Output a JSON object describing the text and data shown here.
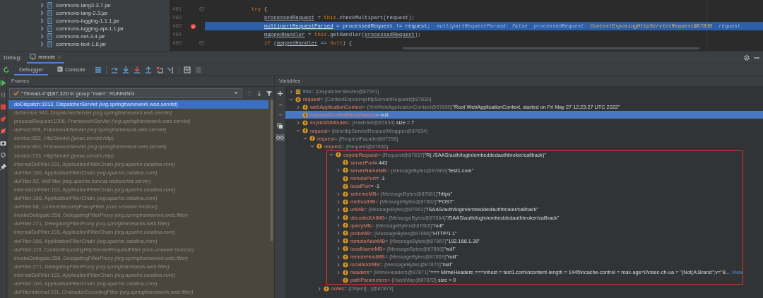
{
  "project_tree": {
    "items": [
      {
        "label": "commons-lang3-3.7.jar",
        "expanded": false
      },
      {
        "label": "commons-lang-2.3.jar",
        "expanded": false
      },
      {
        "label": "commons-logging-1.1.1.jar",
        "expanded": false
      },
      {
        "label": "commons-logging-api-1.1.jar",
        "expanded": false
      },
      {
        "label": "commons-net-3.4.jar",
        "expanded": false
      },
      {
        "label": "commons-text-1.8.jar",
        "expanded": false
      }
    ]
  },
  "editor": {
    "lines": [
      {
        "number": "481",
        "kind": "block",
        "breakpoint": false,
        "selected": false,
        "fold": true,
        "tokens": [
          {
            "t": "try",
            "kind": "keyword"
          },
          {
            "t": " {",
            "kind": "plain"
          }
        ]
      },
      {
        "number": "482",
        "kind": "statement",
        "breakpoint": false,
        "selected": false,
        "fold": false,
        "tokens": [
          {
            "t": "processedRequest",
            "kind": "field"
          },
          {
            "t": " = ",
            "kind": "plain"
          },
          {
            "t": "this",
            "kind": "keyword"
          },
          {
            "t": ".checkMultipart(request);",
            "kind": "plain"
          }
        ]
      },
      {
        "number": "483",
        "kind": "statement",
        "breakpoint": true,
        "selected": true,
        "fold": false,
        "tokens": [
          {
            "t": "multipartRequestParsed",
            "kind": "field"
          },
          {
            "t": " = processedRequest != request;",
            "kind": "plain"
          },
          {
            "t": "  multipartRequestParsed: false  processedRequest: ",
            "kind": "hint"
          },
          {
            "t": "ContextExposingHttpServletRequest@87830",
            "kind": "hintvalue"
          },
          {
            "t": "  request: ",
            "kind": "hint"
          }
        ]
      },
      {
        "number": "484",
        "kind": "statement",
        "breakpoint": false,
        "selected": false,
        "fold": false,
        "tokens": [
          {
            "t": "mappedHandler",
            "kind": "field"
          },
          {
            "t": " = ",
            "kind": "plain"
          },
          {
            "t": "this",
            "kind": "keyword"
          },
          {
            "t": ".getHandler(",
            "kind": "plain"
          },
          {
            "t": "processedRequest",
            "kind": "field"
          },
          {
            "t": ");",
            "kind": "plain"
          }
        ]
      },
      {
        "number": "485",
        "kind": "statement",
        "breakpoint": false,
        "selected": false,
        "fold": true,
        "tokens": [
          {
            "t": "if",
            "kind": "keyword"
          },
          {
            "t": " (",
            "kind": "plain"
          },
          {
            "t": "mappedHandler",
            "kind": "field"
          },
          {
            "t": " == ",
            "kind": "plain"
          },
          {
            "t": "null",
            "kind": "keyword"
          },
          {
            "t": ") {",
            "kind": "plain"
          }
        ]
      }
    ]
  },
  "debug": {
    "label": "Debug:",
    "session_tab": "remote",
    "tabs": [
      {
        "label": "Debugger",
        "selected": true
      },
      {
        "label": "Console",
        "selected": false
      }
    ]
  },
  "frames": {
    "title": "Frames",
    "thread": "\"Thread-4\"@87,320 in group \"main\": RUNNING",
    "items": [
      {
        "text": "doDispatch:1013, DispatcherServlet *(org.springframework.web.servlet)*",
        "selected": true
      },
      {
        "text": "doService:943, DispatcherServlet *(org.springframework.web.servlet)*",
        "selected": false
      },
      {
        "text": "processRequest:1006, FrameworkServlet *(org.springframework.web.servlet)*",
        "selected": false
      },
      {
        "text": "doPost:909, FrameworkServlet *(org.springframework.web.servlet)*",
        "selected": false
      },
      {
        "text": "service:652, HttpServlet *(javax.servlet.http)*",
        "selected": false
      },
      {
        "text": "service:883, FrameworkServlet *(org.springframework.web.servlet)*",
        "selected": false
      },
      {
        "text": "service:733, HttpServlet *(javax.servlet.http)*",
        "selected": false
      },
      {
        "text": "internalDoFilter:231, ApplicationFilterChain *(org.apache.catalina.core)*",
        "selected": false
      },
      {
        "text": "doFilter:166, ApplicationFilterChain *(org.apache.catalina.core)*",
        "selected": false
      },
      {
        "text": "doFilter:52, WsFilter *(org.apache.tomcat.websocket.server)*",
        "selected": false
      },
      {
        "text": "internalDoFilter:193, ApplicationFilterChain *(org.apache.catalina.core)*",
        "selected": false
      },
      {
        "text": "doFilter:166, ApplicationFilterChain *(org.apache.catalina.core)*",
        "selected": false
      },
      {
        "text": "doFilter:68, ContentSecurityPolicyFilter *(com.vmware.horizon)*",
        "selected": false
      },
      {
        "text": "invokeDelegate:358, DelegatingFilterProxy *(org.springframework.web.filter)*",
        "selected": false
      },
      {
        "text": "doFilter:271, DelegatingFilterProxy *(org.springframework.web.filter)*",
        "selected": false
      },
      {
        "text": "internalDoFilter:193, ApplicationFilterChain *(org.apache.catalina.core)*",
        "selected": false
      },
      {
        "text": "doFilter:166, ApplicationFilterChain *(org.apache.catalina.core)*",
        "selected": false
      },
      {
        "text": "doFilter:119, ContextExposingHttpServletRequestFilter *(com.vmware.horizon)*",
        "selected": false
      },
      {
        "text": "invokeDelegate:358, DelegatingFilterProxy *(org.springframework.web.filter)*",
        "selected": false
      },
      {
        "text": "doFilter:271, DelegatingFilterProxy *(org.springframework.web.filter)*",
        "selected": false
      },
      {
        "text": "internalDoFilter:193, ApplicationFilterChain *(org.apache.catalina.core)*",
        "selected": false
      },
      {
        "text": "doFilter:166, ApplicationFilterChain *(org.apache.catalina.core)*",
        "selected": false
      },
      {
        "text": "doFilterInternal:201, CharacterEncodingFilter *(org.springframework.web.filter)*",
        "selected": false
      }
    ]
  },
  "variables": {
    "title": "Variables",
    "items": [
      {
        "name": "this",
        "type": "= {DispatcherServlet@87091}",
        "kind": "object",
        "expanded": false,
        "selected": false
      },
      {
        "name": "request",
        "type": "= {ContextExposingHttpServletRequest@87830}",
        "kind": "parameter",
        "expanded": true,
        "selected": false,
        "children": [
          {
            "name": "webApplicationContext",
            "type": "= {XmlWebApplicationContext@87095}",
            "value": "\"Root WebApplicationContext, started on Fri May 27 12:23:27 UTC 2022\"",
            "kind": "field",
            "expanded": false,
            "selected": false
          },
          {
            "name": "exposedContextBeanNames",
            "value": "= null",
            "kind": "field",
            "selected": true
          },
          {
            "name": "explicitAttributes",
            "type": "= {HashSet@87833}",
            "value": " size = 7",
            "kind": "field",
            "expanded": false,
            "selected": false
          },
          {
            "name": "request",
            "type": "= {IdmHttpServletRequestWrapper@87834}",
            "kind": "field",
            "expanded": true,
            "selected": false,
            "children": [
              {
                "name": "request",
                "type": "= {RequestFacade@87258}",
                "kind": "field",
                "expanded": true,
                "selected": false,
                "children": [
                  {
                    "name": "request",
                    "type": "= {Request@87836}",
                    "kind": "field",
                    "expanded": true,
                    "selected": false,
                    "children": [
                      {
                        "name": "coyoteRequest",
                        "type": "= {Request@87837}",
                        "value": "\"R( /SAAS/auth/login/embeddedauthbroker/callback)\"",
                        "kind": "field",
                        "expanded": true,
                        "selected": false,
                        "boxed": true,
                        "children": [
                          {
                            "name": "serverPort",
                            "value": "= 443",
                            "kind": "field",
                            "selected": false
                          },
                          {
                            "name": "serverNameMB",
                            "type": "= {MessageBytes@87860}",
                            "value": "\"test1.com\"",
                            "kind": "field",
                            "expanded": false,
                            "selected": false
                          },
                          {
                            "name": "remotePort",
                            "value": "= -1",
                            "kind": "field",
                            "selected": false
                          },
                          {
                            "name": "localPort",
                            "value": "= -1",
                            "kind": "field",
                            "selected": false
                          },
                          {
                            "name": "schemeMB",
                            "type": "= {MessageBytes@87861}",
                            "value": "\"https\"",
                            "kind": "field",
                            "expanded": false,
                            "selected": false
                          },
                          {
                            "name": "methodMB",
                            "type": "= {MessageBytes@87862}",
                            "value": "\"POST\"",
                            "kind": "field",
                            "expanded": false,
                            "selected": false
                          },
                          {
                            "name": "uriMB",
                            "type": "= {MessageBytes@87863}",
                            "value": "\"/SAAS/auth/login/embeddedauthbroker/callback\"",
                            "kind": "field",
                            "expanded": false,
                            "selected": false
                          },
                          {
                            "name": "decodedUriMB",
                            "type": "= {MessageBytes@87864}",
                            "value": "\"/SAAS/auth/login/embeddedauthbroker/callback\"",
                            "kind": "field",
                            "expanded": false,
                            "selected": false
                          },
                          {
                            "name": "queryMB",
                            "type": "= {MessageBytes@87865}",
                            "value": "\"null\"",
                            "kind": "field",
                            "expanded": false,
                            "selected": false
                          },
                          {
                            "name": "protoMB",
                            "type": "= {MessageBytes@87866}",
                            "value": "\"HTTP/1.1\"",
                            "kind": "field",
                            "expanded": false,
                            "selected": false
                          },
                          {
                            "name": "remoteAddrMB",
                            "type": "= {MessageBytes@87867}",
                            "value": "\"192.168.1.39\"",
                            "kind": "field",
                            "expanded": false,
                            "selected": false
                          },
                          {
                            "name": "localNameMB",
                            "type": "= {MessageBytes@87868}",
                            "value": "\"null\"",
                            "kind": "field",
                            "expanded": false,
                            "selected": false
                          },
                          {
                            "name": "remoteHostMB",
                            "type": "= {MessageBytes@87869}",
                            "value": "\"null\"",
                            "kind": "field",
                            "expanded": false,
                            "selected": false
                          },
                          {
                            "name": "localAddrMB",
                            "type": "= {MessageBytes@87870}",
                            "value": "\"null\"",
                            "kind": "field",
                            "expanded": false,
                            "selected": false
                          },
                          {
                            "name": "headers",
                            "type": "= {MimeHeaders@87871}",
                            "value": "\"=== MimeHeaders ===\\nhost = test1.com\\ncontent-length = 1445\\ncache-control = max-age=0\\nsec-ch-ua = \"(Not(A:Brand\";v=\"8...",
                            "link": "View",
                            "kind": "field",
                            "expanded": false,
                            "selected": false
                          },
                          {
                            "name": "pathParameters",
                            "type": "= {HashMap@87872}",
                            "value": " size = 0",
                            "kind": "field",
                            "selected": false
                          }
                        ]
                      },
                      {
                        "name": "notes",
                        "type": "= {Object[...]@87873}",
                        "kind": "field",
                        "expanded": false,
                        "selected": false
                      }
                    ]
                  }
                ]
              }
            ]
          }
        ]
      }
    ]
  }
}
